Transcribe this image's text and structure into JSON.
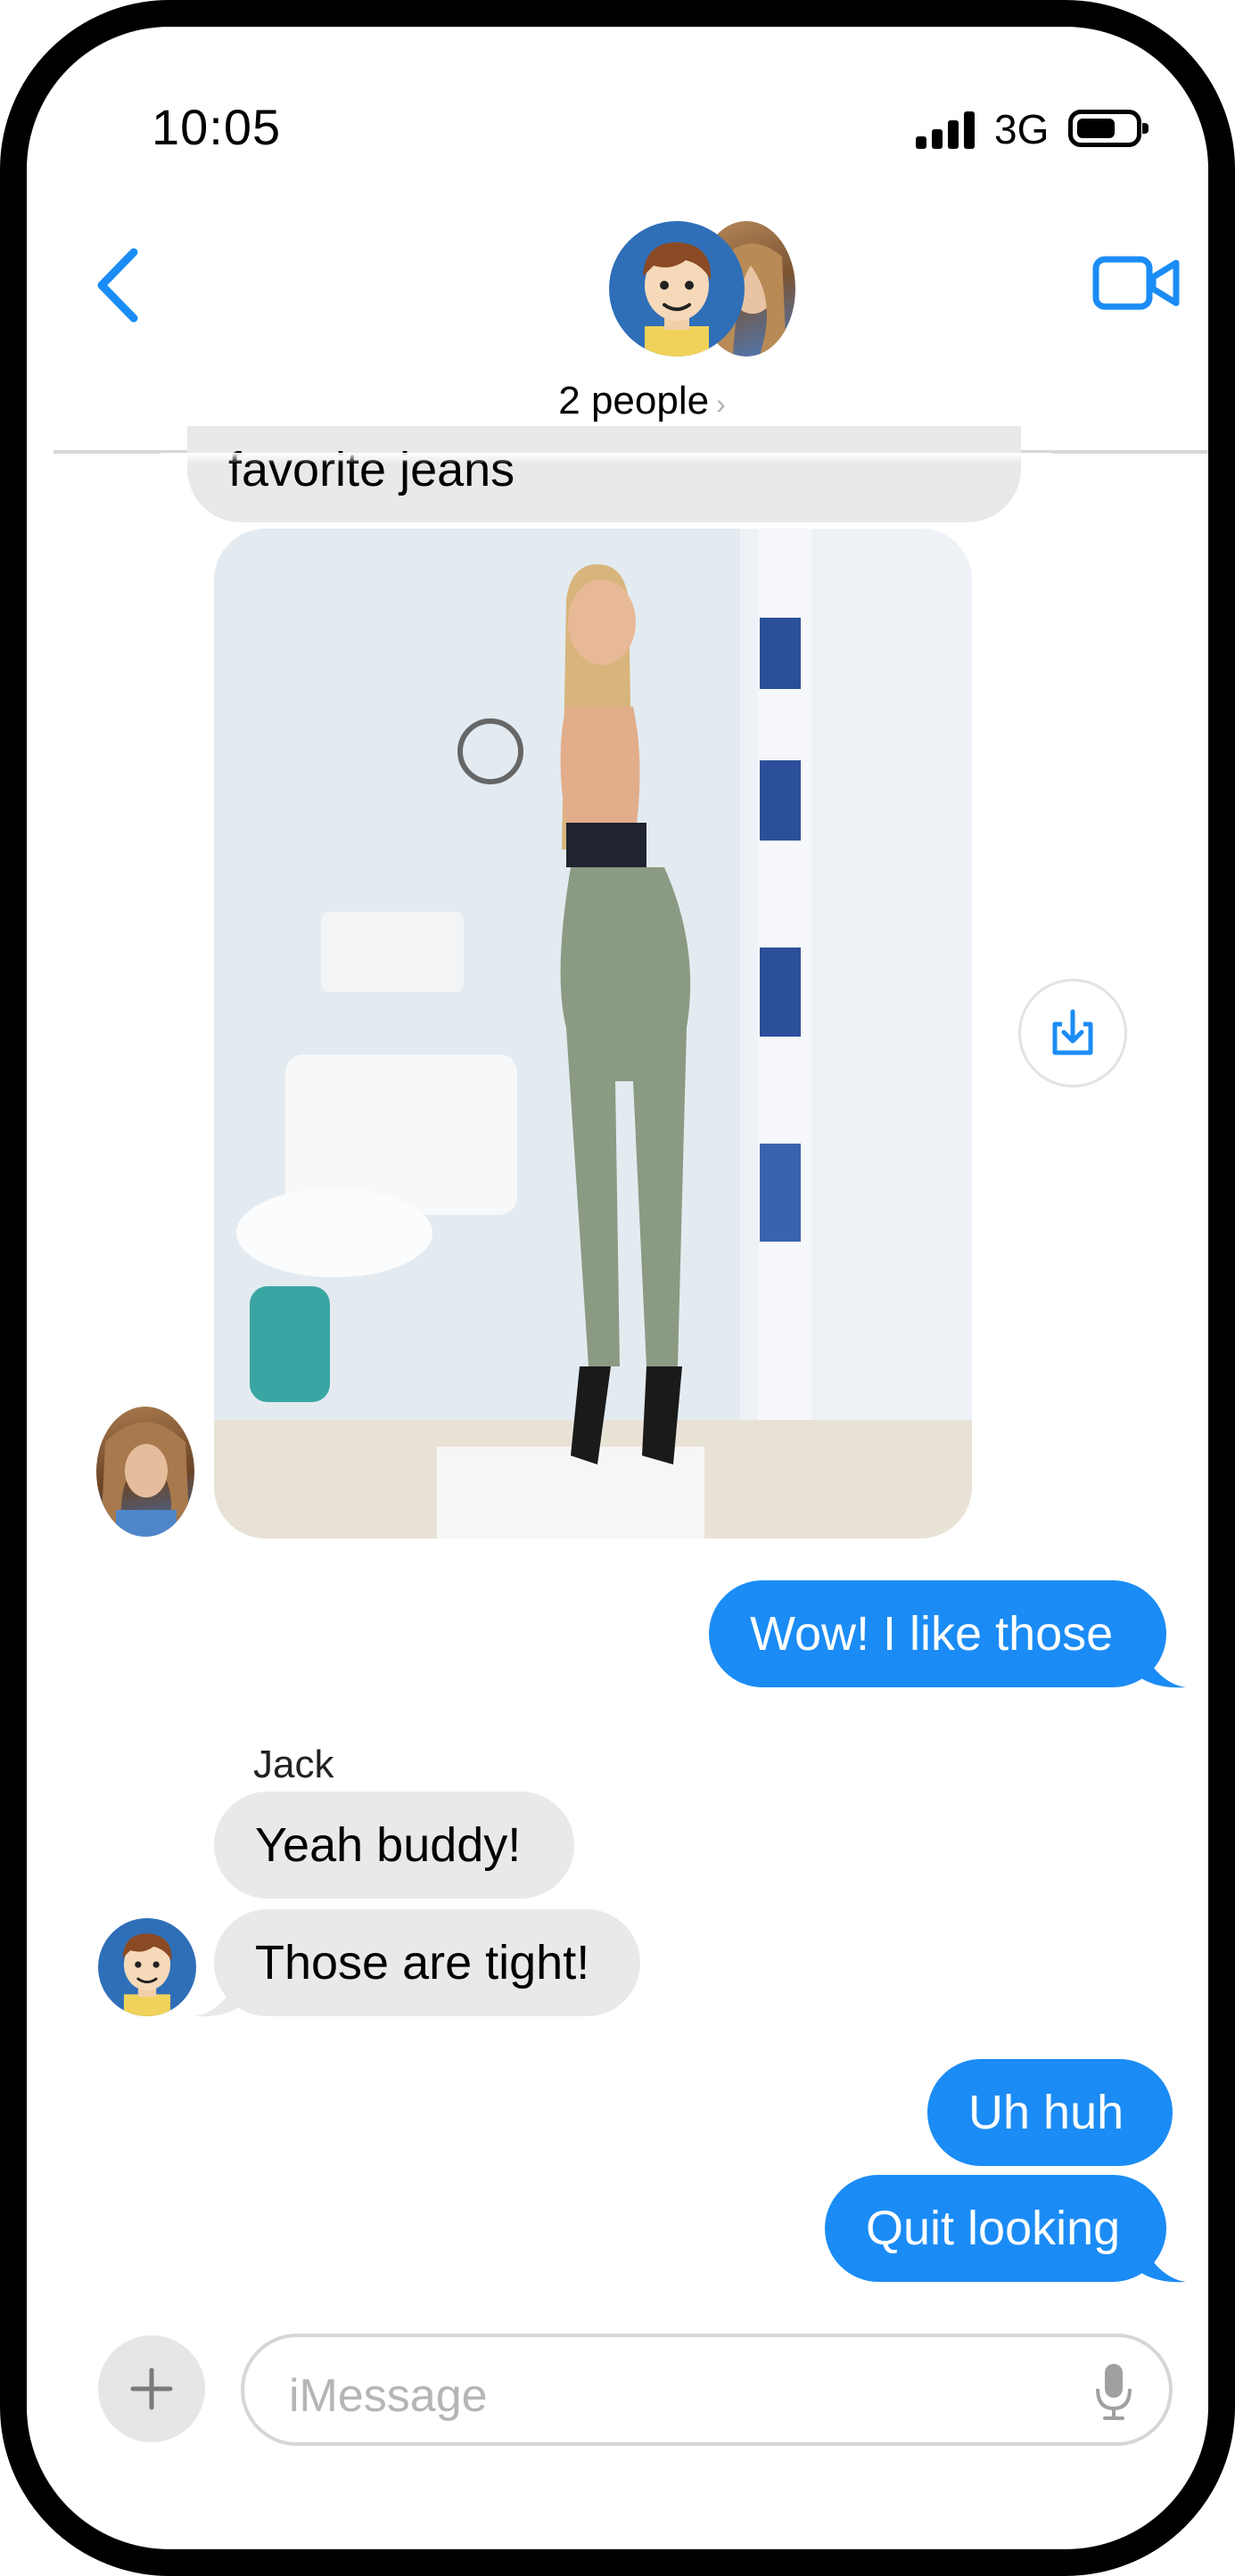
{
  "status_bar": {
    "time": "10:05",
    "network": "3G",
    "icons": [
      "signal-icon",
      "battery-icon"
    ]
  },
  "header": {
    "back_icon": "chevron-left-icon",
    "group_label": "2 people",
    "chevron": "›",
    "video_icon": "video-camera-icon"
  },
  "messages": [
    {
      "from": "woman",
      "type": "text",
      "text": "favorite jeans"
    },
    {
      "from": "woman",
      "type": "image"
    },
    {
      "from": "me",
      "type": "text",
      "text": "Wow!  I like those"
    },
    {
      "from": "jack",
      "sender_name": "Jack",
      "type": "text",
      "text": "Yeah buddy!"
    },
    {
      "from": "jack",
      "type": "text",
      "text": "Those are tight!"
    },
    {
      "from": "me",
      "type": "text",
      "text": "Uh huh"
    },
    {
      "from": "me",
      "type": "text",
      "text": "Quit looking"
    }
  ],
  "composer": {
    "placeholder": "iMessage",
    "plus_icon": "plus-icon",
    "mic_icon": "microphone-icon"
  },
  "colors": {
    "accent": "#1b8cf5",
    "incoming_bubble": "#e9e9eb",
    "frame": "#000000"
  }
}
